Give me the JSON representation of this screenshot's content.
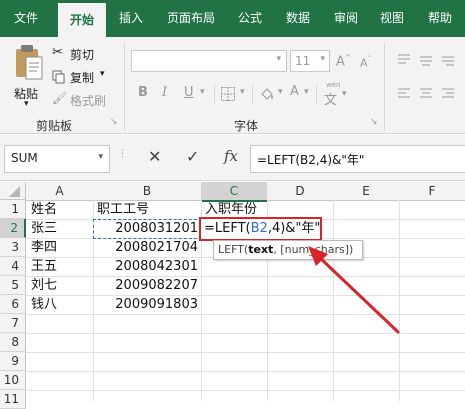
{
  "tabs": [
    "文件",
    "开始",
    "插入",
    "页面布局",
    "公式",
    "数据",
    "审阅",
    "视图",
    "帮助"
  ],
  "clipboard": {
    "paste_label": "粘贴",
    "cut_label": "剪切",
    "copy_label": "复制",
    "format_painter_label": "格式刷",
    "group_label": "剪贴板"
  },
  "font": {
    "size": "11",
    "grow_label": "A",
    "shrink_label": "A",
    "bold": "B",
    "italic": "I",
    "underline": "U",
    "font_color_label": "A",
    "phonetic_label": "wén",
    "group_label": "字体"
  },
  "formula_bar": {
    "name_box": "SUM",
    "cancel_symbol": "✕",
    "enter_symbol": "✓",
    "fx_label": "fx",
    "formula": "=LEFT(B2,4)&\"年\""
  },
  "columns": [
    "A",
    "B",
    "C",
    "D",
    "E",
    "F"
  ],
  "rows": [
    "1",
    "2",
    "3",
    "4",
    "5",
    "6",
    "7",
    "8",
    "9",
    "10",
    "11"
  ],
  "cells": {
    "a1": "姓名",
    "b1": "职工工号",
    "c1": "入职年份",
    "a2": "张三",
    "b2": "2008031201",
    "c2_part1": "=LEFT(",
    "c2_ref": "B2",
    "c2_part2": ",4)&\"年\"",
    "a3": "李四",
    "b3": "2008021704",
    "a4": "王五",
    "b4": "2008042301",
    "a5": "刘七",
    "b5": "2009082207",
    "a6": "钱八",
    "b6": "2009091803"
  },
  "tooltip": {
    "func": "LEFT(",
    "arg_bold": "text",
    "rest": ", [num_chars])"
  },
  "colors": {
    "excel_green": "#217346",
    "highlight_red": "#d9232a",
    "ref_blue": "#2f6fcf"
  }
}
